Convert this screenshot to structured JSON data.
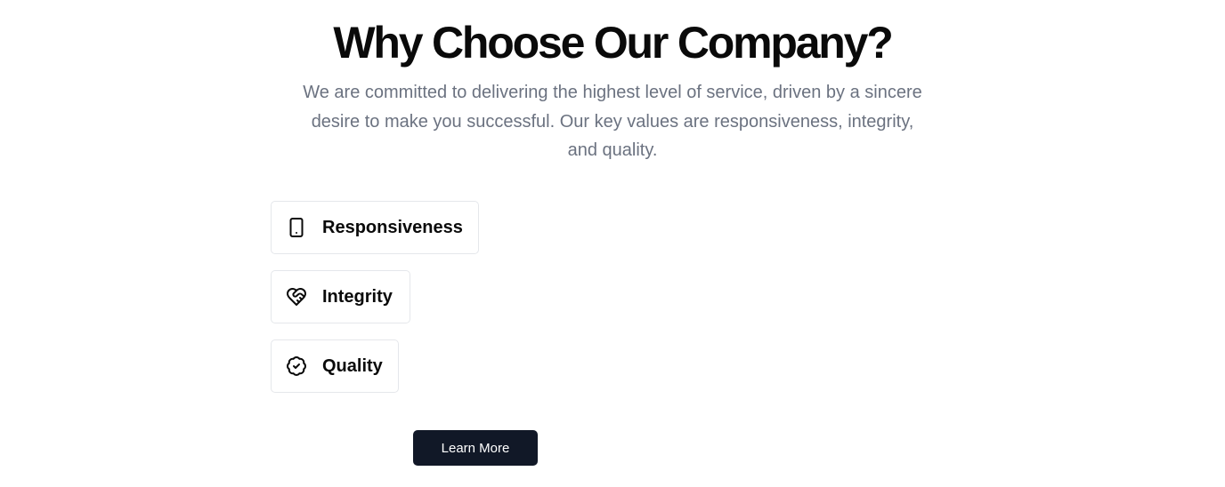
{
  "section": {
    "title": "Why Choose Our Company?",
    "description": "We are committed to delivering the highest level of service, driven by a sincere desire to make you successful. Our key values are responsiveness, integrity, and quality."
  },
  "values": [
    {
      "label": "Responsiveness",
      "icon": "smartphone-icon"
    },
    {
      "label": "Integrity",
      "icon": "handshake-heart-icon"
    },
    {
      "label": "Quality",
      "icon": "badge-check-icon"
    }
  ],
  "cta": {
    "label": "Learn More",
    "background": "#111827",
    "text_color": "#ffffff"
  },
  "colors": {
    "heading": "#0a0a0a",
    "body_text": "#6b7280",
    "card_border": "#e5e7eb"
  }
}
